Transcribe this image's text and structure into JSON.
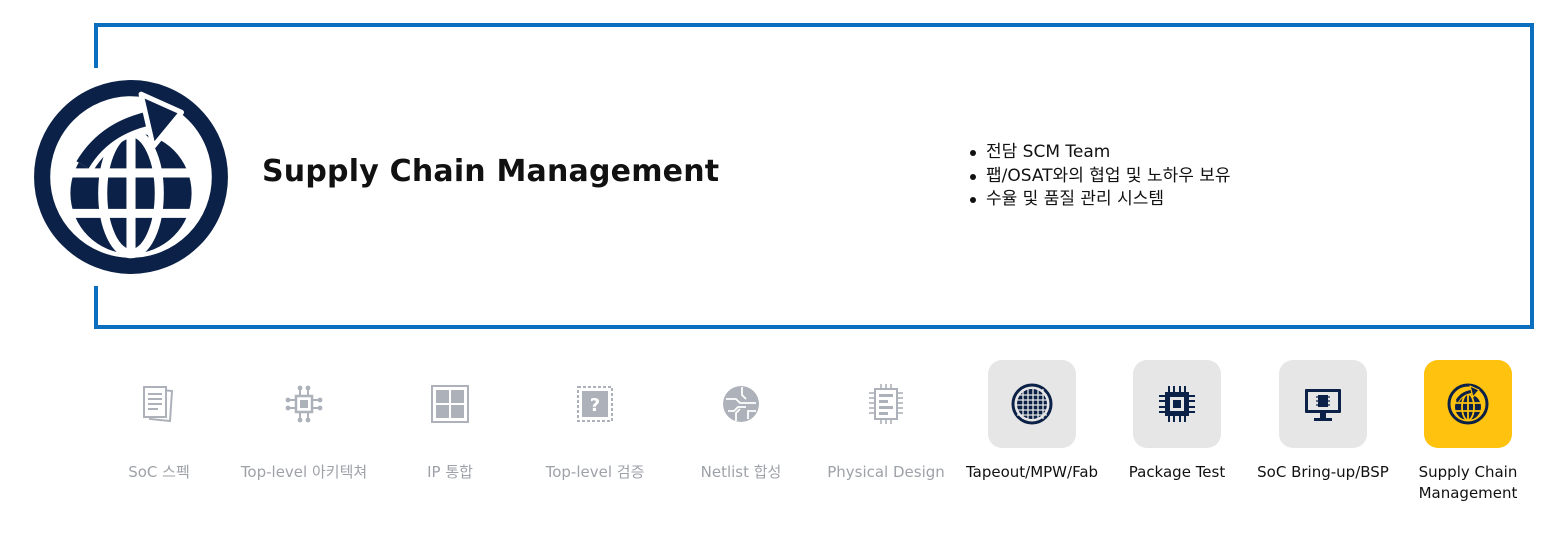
{
  "hero": {
    "title": "Supply Chain Management",
    "icon": "globe-arrow-icon",
    "bullets": [
      "전담 SCM Team",
      "팹/OSAT와의 협업 및 노하우 보유",
      "수율 및 품질 관리 시스템"
    ]
  },
  "steps": [
    {
      "label": "SoC 스펙",
      "icon": "document-icon",
      "state": "disabled"
    },
    {
      "label": "Top-level 아키텍쳐",
      "icon": "chip-circuit-icon",
      "state": "disabled"
    },
    {
      "label": "IP 통합",
      "icon": "grid-chip-icon",
      "state": "disabled"
    },
    {
      "label": "Top-level 검증",
      "icon": "question-chip-icon",
      "state": "disabled"
    },
    {
      "label": "Netlist 합성",
      "icon": "circuit-globe-icon",
      "state": "disabled"
    },
    {
      "label": "Physical Design",
      "icon": "chip-layout-icon",
      "state": "disabled"
    },
    {
      "label": "Tapeout/MPW/Fab",
      "icon": "wafer-icon",
      "state": "enabled"
    },
    {
      "label": "Package Test",
      "icon": "cpu-package-icon",
      "state": "enabled"
    },
    {
      "label": "SoC Bring-up/BSP",
      "icon": "monitor-chip-icon",
      "state": "enabled"
    },
    {
      "label": "Supply Chain Management",
      "icon": "globe-arrow-icon",
      "state": "selected"
    }
  ],
  "colors": {
    "frame_border": "#0a6fbf",
    "icon_navy": "#0b2147",
    "active_tile": "#e6e6e6",
    "selected_tile": "#ffc20e",
    "disabled_text": "#9ea2a8"
  }
}
